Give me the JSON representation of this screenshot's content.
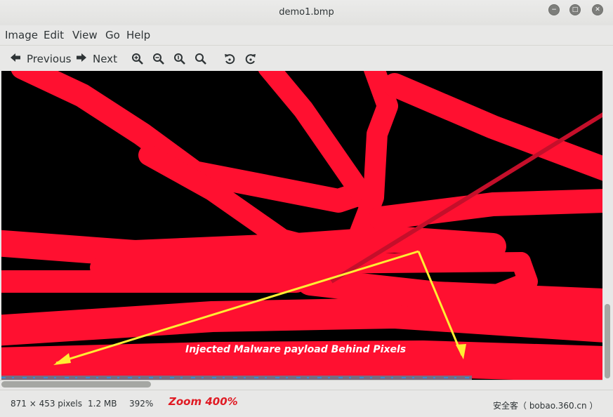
{
  "window": {
    "title": "demo1.bmp"
  },
  "menubar": {
    "items": [
      "Image",
      "Edit",
      "View",
      "Go",
      "Help"
    ]
  },
  "toolbar": {
    "previous_label": "Previous",
    "next_label": "Next",
    "icons": [
      "arrow-left-icon",
      "arrow-right-icon",
      "zoom-in-icon",
      "zoom-out-icon",
      "zoom-fit-icon",
      "zoom-best-icon",
      "rotate-left-icon",
      "rotate-right-icon"
    ]
  },
  "image": {
    "annotation": "Injected Malware payload Behind Pixels",
    "colors": {
      "stroke": "#ff1030",
      "background": "#000000",
      "arrow": "#ffee33",
      "annotation_text": "#ffffff"
    }
  },
  "statusbar": {
    "dimensions": "871 × 453 pixels",
    "size": "1.2 MB",
    "zoom": "392%",
    "zoom_note": "Zoom 400%",
    "zoom_note_color": "#e01b24",
    "watermark": "安全客（ bobao.360.cn ）"
  }
}
